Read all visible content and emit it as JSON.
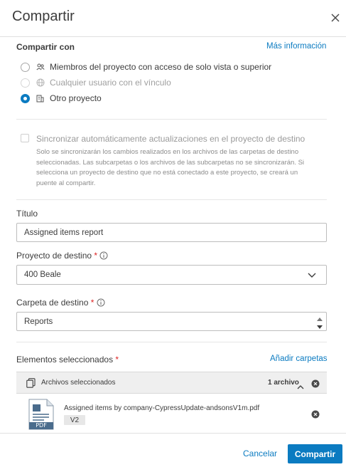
{
  "dialog": {
    "title": "Compartir"
  },
  "share_with": {
    "label": "Compartir con",
    "more_info_link": "Más información",
    "options": [
      {
        "label": "Miembros del proyecto con acceso de solo vista o superior",
        "icon": "members-icon",
        "state": "unselected"
      },
      {
        "label": "Cualquier usuario con el vínculo",
        "icon": "globe-icon",
        "state": "disabled"
      },
      {
        "label": "Otro proyecto",
        "icon": "project-icon",
        "state": "selected"
      }
    ]
  },
  "sync": {
    "label": "Sincronizar automáticamente actualizaciones en el proyecto de destino",
    "help_lines": [
      "Solo se sincronizarán los cambios realizados en los archivos de las carpetas de destino",
      "seleccionadas. Las subcarpetas o los archivos de las subcarpetas no se sincronizarán. Si",
      "selecciona un proyecto de destino que no está conectado a este proyecto, se creará un",
      "puente al compartir."
    ],
    "checked": false
  },
  "form": {
    "title_label": "Título",
    "title_value": "Assigned items report",
    "dest_project_label": "Proyecto de destino",
    "dest_project_value": "400 Beale",
    "dest_folder_label": "Carpeta de destino",
    "dest_folder_value": "Reports",
    "required_mark": "*"
  },
  "selected_items": {
    "label": "Elementos seleccionados",
    "add_folders_link": "Añadir carpetas",
    "files_header": "Archivos seleccionados",
    "files_count": "1 archivo",
    "files": [
      {
        "name": "Assigned items by company-CypressUpdate-andsonsV1m.pdf",
        "version": "V2",
        "type_label": "PDF"
      }
    ]
  },
  "footer": {
    "cancel_label": "Cancelar",
    "share_label": "Compartir"
  },
  "colors": {
    "accent": "#0b7bc1",
    "required": "#dd2222",
    "pdf_blue": "#4a6c8c"
  }
}
